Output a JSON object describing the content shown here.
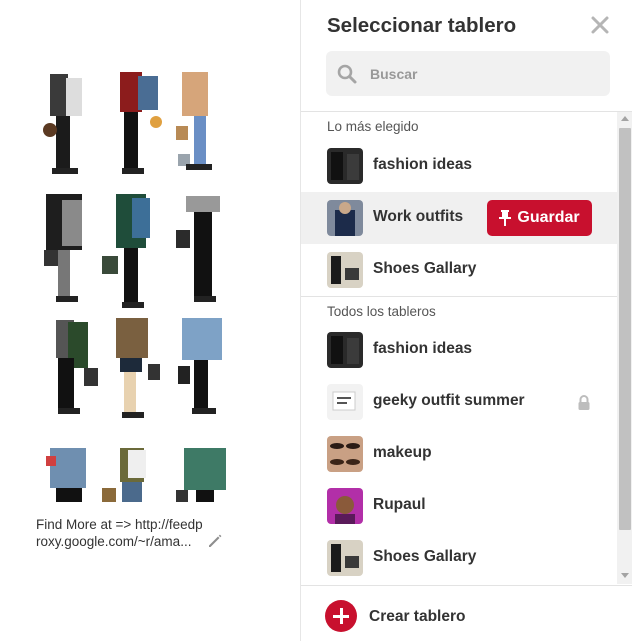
{
  "pin": {
    "description": "Find More at => http://feedproxy.google.com/~r/ama...",
    "image": "fashion-outfits-collage"
  },
  "panel": {
    "title": "Seleccionar tablero",
    "search_placeholder": "Buscar",
    "sections": {
      "top": "Lo más elegido",
      "all": "Todos los tableros"
    },
    "top_boards": [
      {
        "label": "fashion ideas",
        "thumb": "dark"
      },
      {
        "label": "Work outfits",
        "thumb": "navy",
        "active": true
      },
      {
        "label": "Shoes Gallary",
        "thumb": "shoes"
      }
    ],
    "all_boards": [
      {
        "label": "fashion ideas",
        "thumb": "dark"
      },
      {
        "label": "geeky outfit summer",
        "thumb": "white",
        "secret": true
      },
      {
        "label": "makeup",
        "thumb": "eyes"
      },
      {
        "label": "Rupaul",
        "thumb": "pink"
      },
      {
        "label": "Shoes Gallary",
        "thumb": "shoes"
      }
    ],
    "save_label": "Guardar",
    "create_label": "Crear tablero"
  },
  "colors": {
    "accent": "#c8102e",
    "text": "#333333",
    "muted": "#999999",
    "search_bg": "#f1f1f1",
    "active_row": "#f0f0f0"
  }
}
